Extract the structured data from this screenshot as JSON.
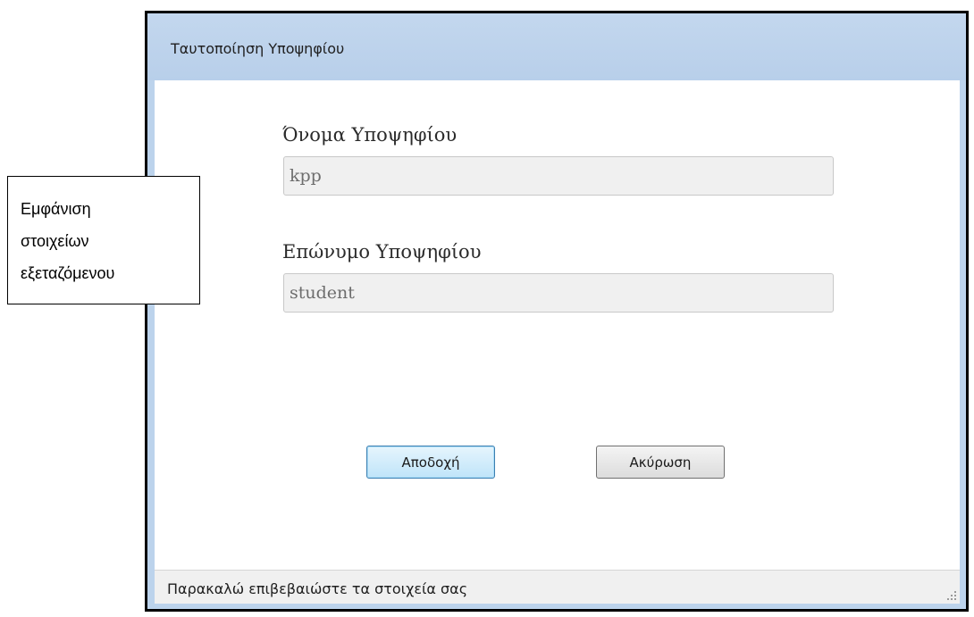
{
  "window": {
    "title": "Ταυτοποίηση Υποψηφίου"
  },
  "form": {
    "first_name_label": "Όνομα Υποψηφίου",
    "first_name_value": "kpp",
    "last_name_label": "Επώνυμο Υποψηφίου",
    "last_name_value": "student"
  },
  "buttons": {
    "accept_label": "Αποδοχή",
    "cancel_label": "Ακύρωση"
  },
  "status_bar": {
    "text": "Παρακαλώ επιβεβαιώστε τα στοιχεία σας"
  },
  "callout": {
    "lines": [
      "Εμφάνιση",
      "στοιχείων",
      "εξεταζόμενου"
    ]
  },
  "colors": {
    "frame": "#bcd3ec",
    "accept_border": "#3c7fb1",
    "field_bg": "#f0f0f0"
  },
  "icons": {
    "resize_grip": "resize-grip-icon"
  }
}
